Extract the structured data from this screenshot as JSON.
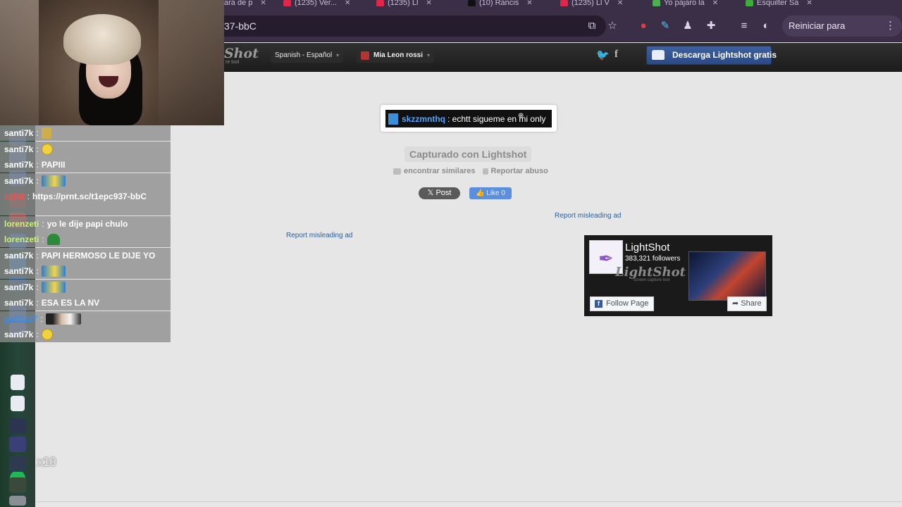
{
  "browser": {
    "tabs": [
      {
        "label": "ara de p",
        "color": "#6a5a7a"
      },
      {
        "label": "(1235) Ver...",
        "color": "#e1254b"
      },
      {
        "label": "(1235) Ll",
        "color": "#e1254b"
      },
      {
        "label": "(10) Rancis",
        "color": "#111111"
      },
      {
        "label": "(1235) Ll V",
        "color": "#e1254b"
      },
      {
        "label": "Yo pajaro la",
        "color": "#4caf50"
      },
      {
        "label": "Esquilter Sa",
        "color": "#3cae3c"
      }
    ],
    "url_fragment": "37-bbC",
    "update_button": "Reiniciar para actualizar"
  },
  "site": {
    "logo_text": "Shot",
    "logo_sub": "re tool",
    "language": "Spanish - Español",
    "user_name": "Mia Leon rossi",
    "download_button": "Descarga Lightshot gratis"
  },
  "screenshot": {
    "username": "skzzmnthq",
    "message": ": echtt sigueme en mi only"
  },
  "captured_label": "Capturado con Lightshot",
  "links": {
    "similar": "encontrar similares",
    "report_abuse": "Reportar abuso",
    "post": "Post",
    "like": "Like 0",
    "report_ad_right": "Report misleading ad",
    "report_ad_left": "Report misleading ad"
  },
  "fb_widget": {
    "title": "LightShot",
    "followers": "383,321 followers",
    "brand": "LightShot",
    "brand_sub": "screen capture tool",
    "follow_button": "Follow Page",
    "share_button": "Share"
  },
  "chat": [
    {
      "user": "santi7k",
      "user_color": "#ffffff",
      "msg": "",
      "emote": "emote-small"
    },
    {
      "user": "santi7k",
      "user_color": "#ffffff",
      "msg": "",
      "emote": "emote-face"
    },
    {
      "user": "santi7k",
      "user_color": "#ffffff",
      "msg": "PAPIII",
      "emote": ""
    },
    {
      "user": "santi7k",
      "user_color": "#ffffff",
      "msg": "",
      "emote": "emote-pika"
    },
    {
      "user": "echtt",
      "user_color": "#ff4b4b",
      "msg": "https://prnt.sc/t1epc937-bbC",
      "emote": ""
    },
    {
      "user": "lorenzeti",
      "user_color": "#c9f27a",
      "msg": "yo le dije papi chulo",
      "emote": ""
    },
    {
      "user": "lorenzeti",
      "user_color": "#c9f27a",
      "msg": "",
      "emote": "emote-green"
    },
    {
      "user": "santi7k",
      "user_color": "#ffffff",
      "msg": "PAPI HERMOSO LE DIJE YO",
      "emote": ""
    },
    {
      "user": "santi7k",
      "user_color": "#ffffff",
      "msg": "",
      "emote": "emote-pika"
    },
    {
      "user": "santi7k",
      "user_color": "#ffffff",
      "msg": "",
      "emote": "emote-pika"
    },
    {
      "user": "santi7k",
      "user_color": "#ffffff",
      "msg": "ESA ES LA NV",
      "emote": ""
    },
    {
      "user": "gab1zzT",
      "user_color": "#2f8fff",
      "msg": "",
      "emote": "emote-photo"
    },
    {
      "user": "santi7k",
      "user_color": "#ffffff",
      "msg": "",
      "emote": "emote-face"
    }
  ],
  "overlay": {
    "multiplier": "x10"
  }
}
